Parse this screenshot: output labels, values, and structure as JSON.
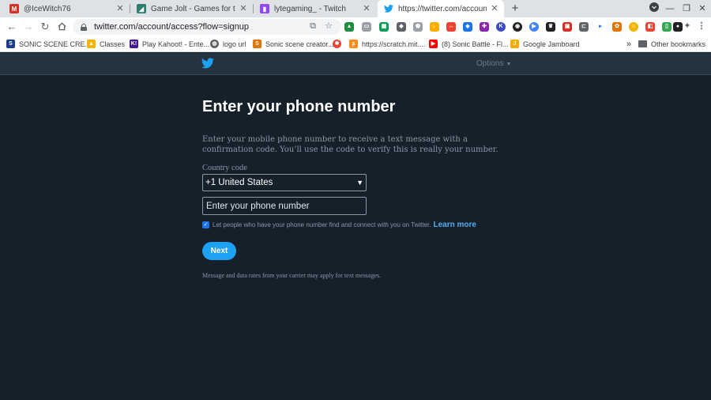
{
  "browser": {
    "tabs": [
      {
        "title": "@IceWitch76",
        "favicon": "gmail-icon",
        "color": "#d93025"
      },
      {
        "title": "Game Jolt - Games for the love o",
        "favicon": "gamejolt-icon",
        "color": "#2f7f6f"
      },
      {
        "title": "lytegaming_ - Twitch",
        "favicon": "twitch-icon",
        "color": "#9146ff"
      },
      {
        "title": "https://twitter.com/account/acc",
        "favicon": "twitter-icon",
        "color": "#1da1f2"
      }
    ],
    "new_tab": "+",
    "url": "twitter.com/account/access?flow=signup",
    "bookmarks": [
      {
        "label": "SONIC SCENE CRE...",
        "icon": "sonic-icon",
        "color": "#1a3c8a"
      },
      {
        "label": "Classes",
        "icon": "classroom-icon",
        "color": "#f4b400"
      },
      {
        "label": "Play Kahoot! - Ente...",
        "icon": "kahoot-icon",
        "color": "#46178f",
        "glyph": "K!"
      },
      {
        "label": "logo url",
        "icon": "globe-icon",
        "color": "#5f6368"
      },
      {
        "label": "Sonic scene creator...",
        "icon": "sonic-creator-icon",
        "color": "#e37400"
      },
      {
        "label": "",
        "icon": "pinwheel-icon",
        "color": "#ea4335"
      },
      {
        "label": "https://scratch.mit....",
        "icon": "scratch-icon",
        "color": "#ff8c1a"
      },
      {
        "label": "(8) Sonic Battle - Fl...",
        "icon": "youtube-icon",
        "color": "#ff0000"
      },
      {
        "label": "Google Jamboard",
        "icon": "jamboard-icon",
        "color": "#f9ab00"
      }
    ],
    "overflow": "»",
    "other_bookmarks": "Other bookmarks"
  },
  "twitter": {
    "options_label": "Options",
    "heading": "Enter your phone number",
    "description": "Enter your mobile phone number to receive a text message with a confirmation code. You’ll use the code to verify this is really your number.",
    "country_label": "Country code",
    "country_value": "+1 United States",
    "phone_placeholder": "Enter your phone number",
    "consent_checked": true,
    "consent_text": "Let people who have your phone number find and connect with you on Twitter.",
    "learn_more": "Learn more",
    "next_label": "Next",
    "rates_note": "Message and data rates from your carrier may apply for text messages."
  },
  "colors": {
    "page_bg": "#15202b",
    "header_bg": "#253341",
    "accent": "#1da1f2",
    "link": "#55acee",
    "muted_text": "#8899a6"
  }
}
